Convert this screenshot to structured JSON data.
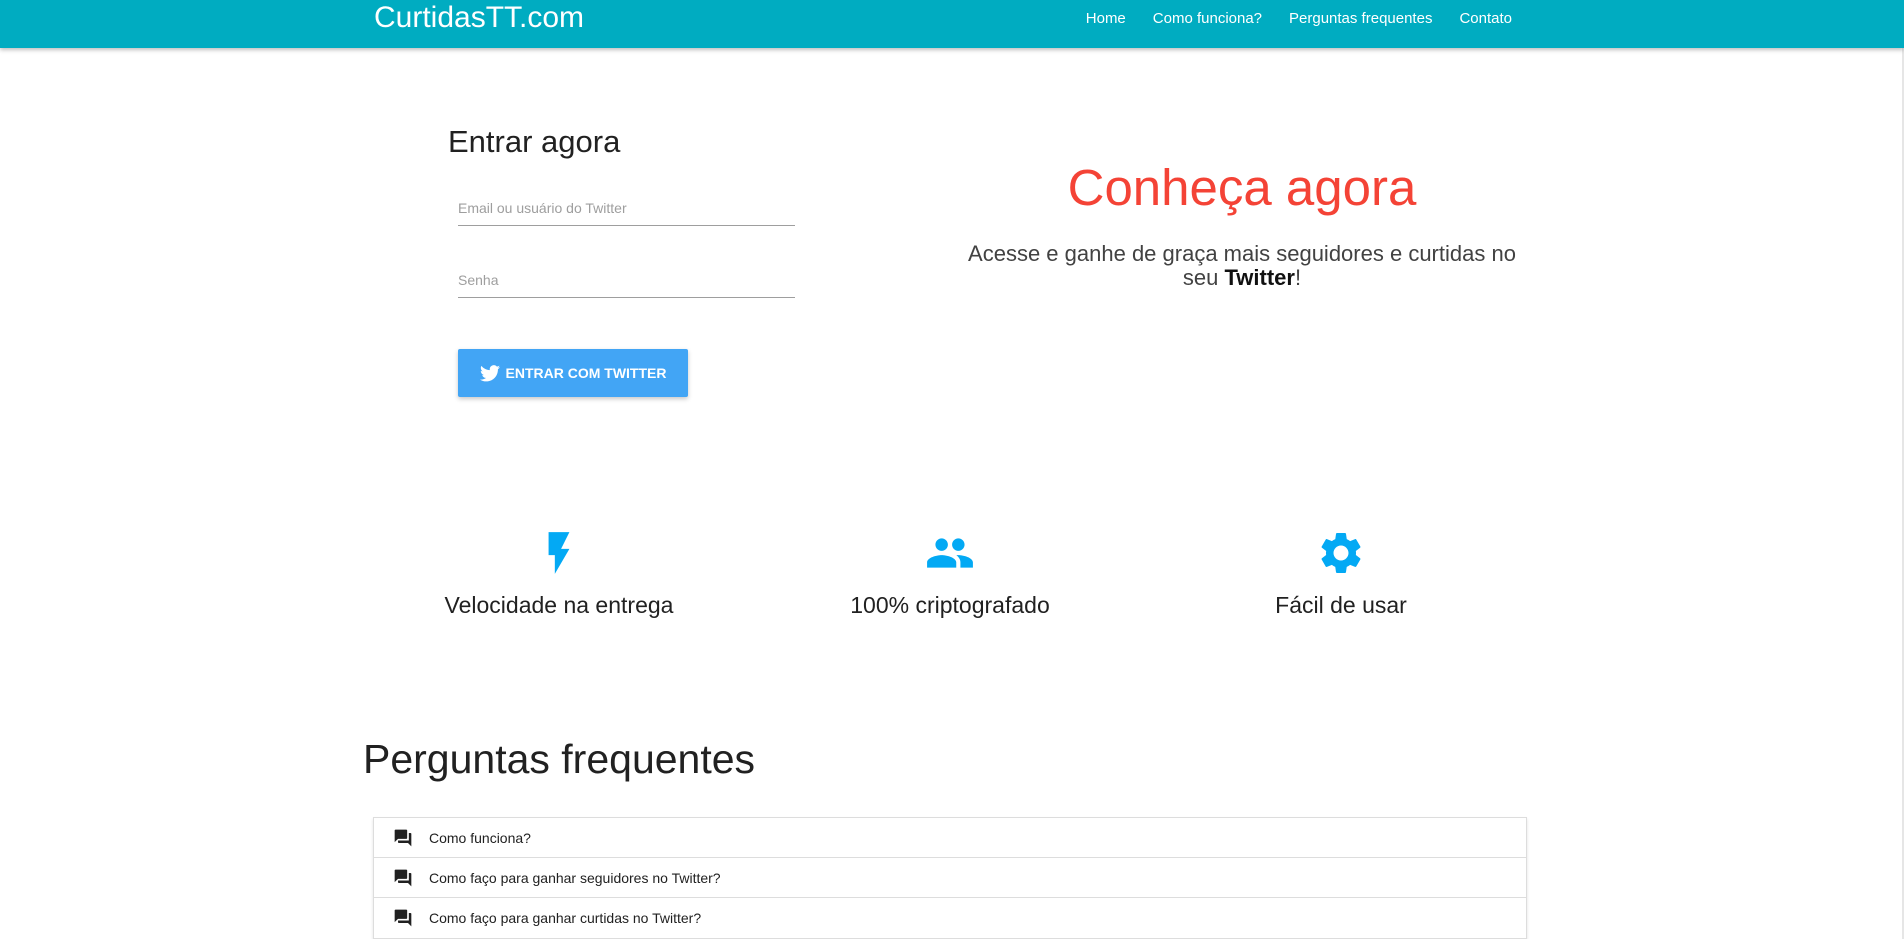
{
  "navbar": {
    "brand": "CurtidasTT.com",
    "links": [
      "Home",
      "Como funciona?",
      "Perguntas frequentes",
      "Contato"
    ],
    "background_color": "#00acc1"
  },
  "login": {
    "title": "Entrar agora",
    "email_placeholder": "Email ou usuário do Twitter",
    "password_placeholder": "Senha",
    "button_label": "ENTRAR COM TWITTER",
    "button_icon": "twitter-bird-icon",
    "button_color": "#42a5f5"
  },
  "hero": {
    "title": "Conheça agora",
    "text_before": "Acesse e ganhe de graça mais seguidores e curtidas no seu ",
    "text_strong": "Twitter",
    "text_after": "!",
    "title_color": "#f44336"
  },
  "features": [
    {
      "icon": "flash-icon",
      "label": "Velocidade na entrega"
    },
    {
      "icon": "people-icon",
      "label": "100% criptografado"
    },
    {
      "icon": "gear-icon",
      "label": "Fácil de usar"
    }
  ],
  "feature_icon_color": "#03a9f4",
  "faq": {
    "title": "Perguntas frequentes",
    "items": [
      {
        "icon": "forum-icon",
        "question": "Como funciona?"
      },
      {
        "icon": "forum-icon",
        "question": "Como faço para ganhar seguidores no Twitter?"
      },
      {
        "icon": "forum-icon",
        "question": "Como faço para ganhar curtidas no Twitter?"
      }
    ]
  }
}
